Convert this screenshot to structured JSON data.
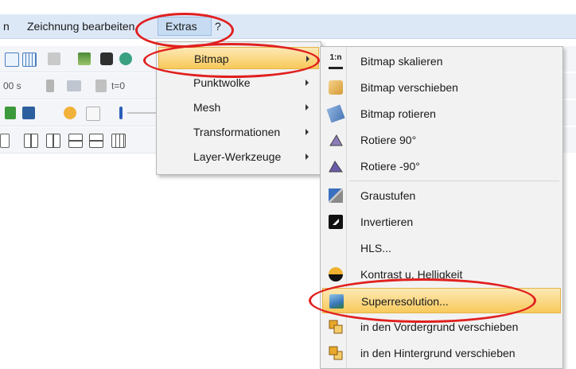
{
  "menubar": {
    "edge_label": "n",
    "edit_drawing": "Zeichnung bearbeiten",
    "extras": "Extras",
    "help": "?"
  },
  "toolbar": {
    "time_label": "00 s",
    "t0_label": "t=0"
  },
  "extras_menu": {
    "items": [
      {
        "label": "Bitmap"
      },
      {
        "label": "Punktwolke"
      },
      {
        "label": "Mesh"
      },
      {
        "label": "Transformationen"
      },
      {
        "label": "Layer-Werkzeuge"
      }
    ]
  },
  "bitmap_submenu": {
    "scale_icon_text": "1:n",
    "items": [
      {
        "label": "Bitmap skalieren",
        "icon": "scale-icon"
      },
      {
        "label": "Bitmap verschieben",
        "icon": "move-hand-icon"
      },
      {
        "label": "Bitmap rotieren",
        "icon": "rotate-icon"
      },
      {
        "label": "Rotiere 90°",
        "icon": "rotate-90-icon"
      },
      {
        "label": "Rotiere -90°",
        "icon": "rotate-minus-90-icon"
      },
      {
        "label": "Graustufen",
        "icon": "grayscale-icon"
      },
      {
        "label": "Invertieren",
        "icon": "invert-icon"
      },
      {
        "label": "HLS...",
        "icon": ""
      },
      {
        "label": "Kontrast u. Helligkeit",
        "icon": "contrast-icon"
      },
      {
        "label": "Superresolution...",
        "icon": "superresolution-icon"
      },
      {
        "label": "in den Vordergrund verschieben",
        "icon": "bring-to-front-icon"
      },
      {
        "label": "in den Hintergrund verschieben",
        "icon": "send-to-back-icon"
      }
    ]
  },
  "colors": {
    "highlight": "#f8c95a",
    "annotation_ring": "#e0201f",
    "menubar": "#dde8f7"
  }
}
